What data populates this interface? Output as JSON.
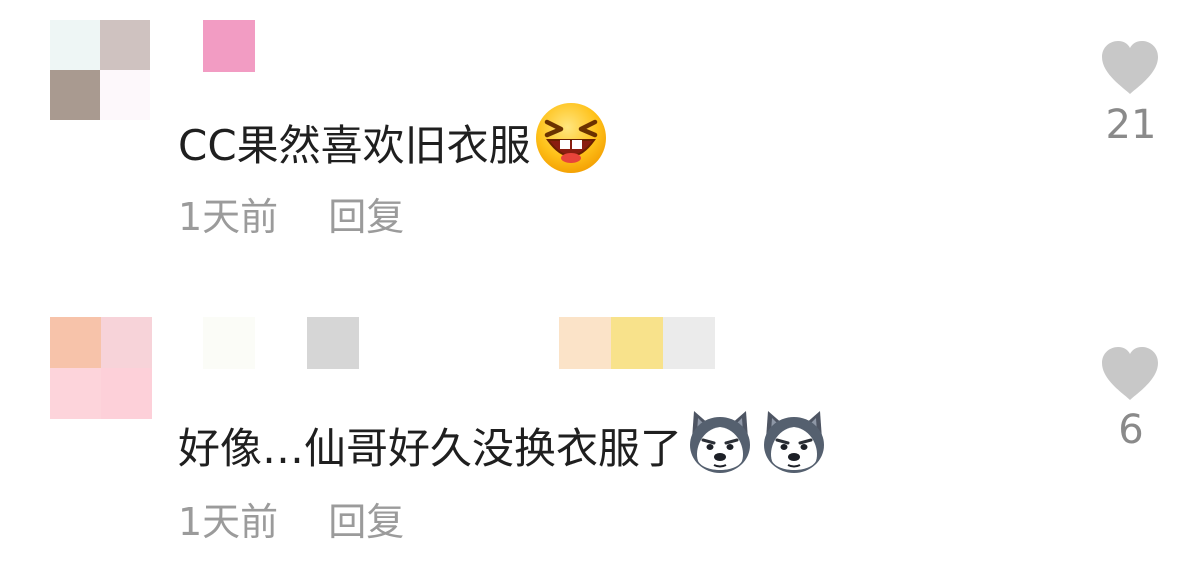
{
  "comments": [
    {
      "text": "CC果然喜欢旧衣服",
      "emoji": [
        "laughing-squint-emoji"
      ],
      "time": "1天前",
      "reply_label": "回复",
      "likes": "21",
      "avatar_colors": [
        "#eef6f5",
        "#cfc2c0",
        "#a99a90",
        "#fdf8fb"
      ],
      "username_colors": [
        "#f29cc3"
      ]
    },
    {
      "text": "好像…仙哥好久没换衣服了",
      "emoji": [
        "husky-dog-emoji",
        "husky-dog-emoji"
      ],
      "time": "1天前",
      "reply_label": "回复",
      "likes": "6",
      "avatar_colors": [
        "#f7c3aa",
        "#f7d3d9",
        "#fdd4db",
        "#fdd0d9"
      ],
      "username_colors": [
        "#fbfcf7",
        "#d6d6d6",
        "#fbe3c8",
        "#f8e28b",
        "#ebebeb"
      ]
    }
  ],
  "icons": {
    "like": "heart-icon",
    "like_color": "#c8c8c8"
  }
}
